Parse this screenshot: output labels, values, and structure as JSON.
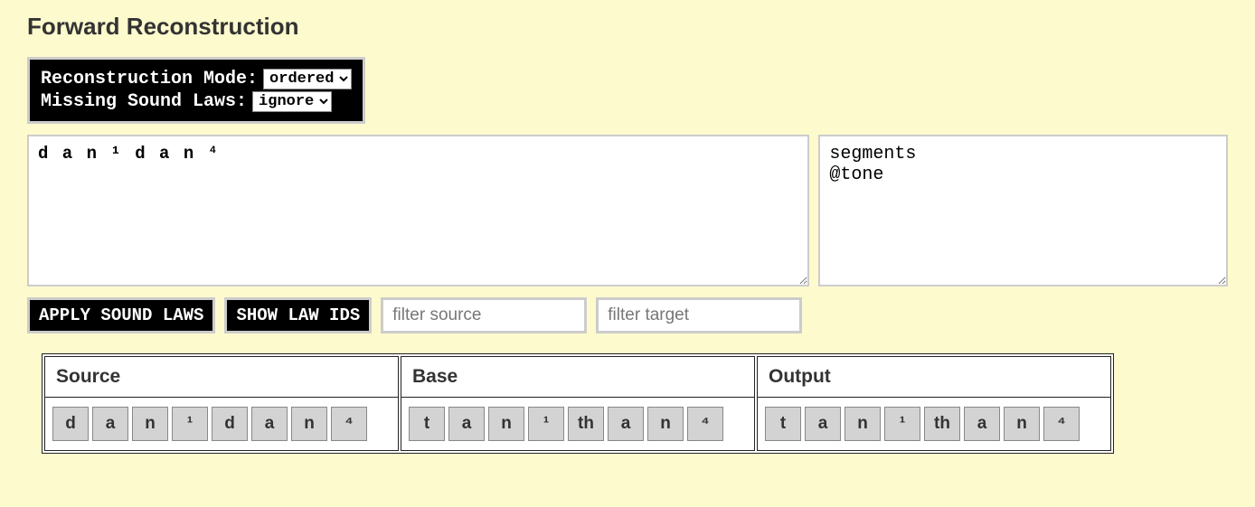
{
  "title": "Forward Reconstruction",
  "settings": {
    "mode_label": "Reconstruction Mode:",
    "mode_value": "ordered",
    "missing_label": "Missing Sound Laws:",
    "missing_value": "ignore"
  },
  "input_text": "d a n ¹ d a n ⁴",
  "tiers_text": "segments\n@tone",
  "buttons": {
    "apply": "APPLY SOUND LAWS",
    "show_ids": "SHOW LAW IDS"
  },
  "filters": {
    "source_placeholder": "filter source",
    "target_placeholder": "filter target"
  },
  "table": {
    "headers": {
      "source": "Source",
      "base": "Base",
      "output": "Output"
    },
    "source": [
      "d",
      "a",
      "n",
      "¹",
      "d",
      "a",
      "n",
      "⁴"
    ],
    "base": [
      "t",
      "a",
      "n",
      "¹",
      "th",
      "a",
      "n",
      "⁴"
    ],
    "output": [
      "t",
      "a",
      "n",
      "¹",
      "th",
      "a",
      "n",
      "⁴"
    ]
  }
}
